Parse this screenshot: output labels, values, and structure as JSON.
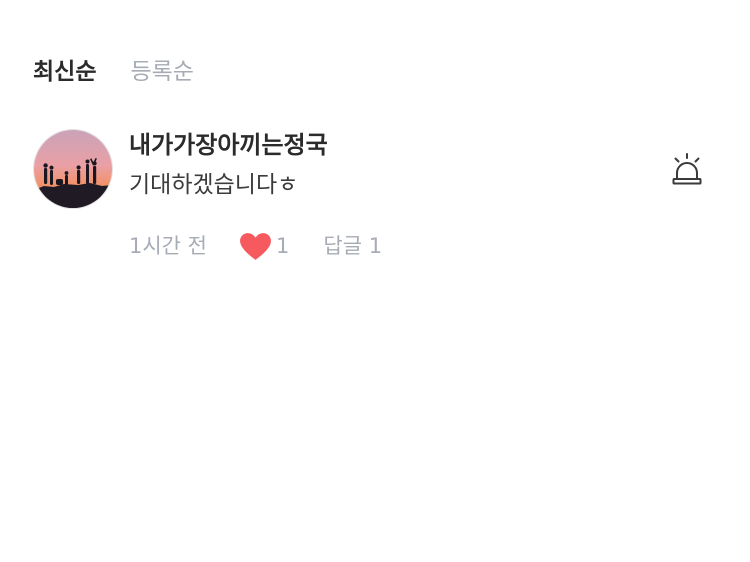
{
  "sort": {
    "latest": "최신순",
    "registered": "등록순"
  },
  "comment": {
    "author": "내가가장아끼는정국",
    "text": "기대하겠습니다ㅎ",
    "time": "1시간 전",
    "likes": "1",
    "reply": "답글 1",
    "liked": true
  },
  "icons": {
    "like": "heart-icon",
    "report": "siren-icon"
  },
  "colors": {
    "heart": "#f65a5e",
    "text_primary": "#2b2b2b",
    "text_muted": "#a7acb4"
  }
}
